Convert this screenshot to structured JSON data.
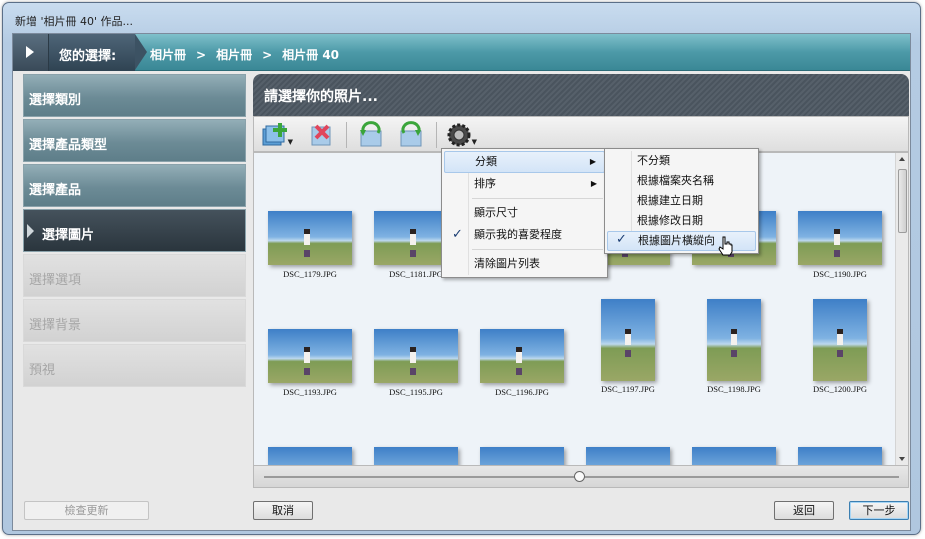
{
  "window": {
    "title": "新增 '相片冊 40' 作品..."
  },
  "breadcrumb": {
    "label": "您的選擇:",
    "path": [
      "相片冊",
      "相片冊",
      "相片冊 40"
    ],
    "separator": ">"
  },
  "nav": {
    "items": [
      {
        "label": "選擇類別",
        "state": "normal"
      },
      {
        "label": "選擇產品類型",
        "state": "normal"
      },
      {
        "label": "選擇產品",
        "state": "normal"
      },
      {
        "label": "選擇圖片",
        "state": "active"
      },
      {
        "label": "選擇選項",
        "state": "disabled"
      },
      {
        "label": "選擇背景",
        "state": "disabled"
      },
      {
        "label": "預視",
        "state": "disabled"
      }
    ]
  },
  "panel": {
    "title": "請選擇你的照片..."
  },
  "toolbar": {
    "icons": [
      "add-photos-icon",
      "remove-photo-icon",
      "rotate-left-icon",
      "rotate-right-icon",
      "settings-gear-icon"
    ]
  },
  "photos": [
    {
      "name": "DSC_1179.JPG",
      "orientation": "landscape"
    },
    {
      "name": "DSC_1181.JPG",
      "orientation": "landscape"
    },
    {
      "name": "",
      "orientation": "landscape"
    },
    {
      "name": "",
      "orientation": "landscape"
    },
    {
      "name": "",
      "orientation": "landscape"
    },
    {
      "name": "DSC_1190.JPG",
      "orientation": "landscape"
    },
    {
      "name": "DSC_1193.JPG",
      "orientation": "landscape"
    },
    {
      "name": "DSC_1195.JPG",
      "orientation": "landscape"
    },
    {
      "name": "DSC_1196.JPG",
      "orientation": "landscape"
    },
    {
      "name": "DSC_1197.JPG",
      "orientation": "portrait"
    },
    {
      "name": "DSC_1198.JPG",
      "orientation": "portrait"
    },
    {
      "name": "DSC_1200.JPG",
      "orientation": "portrait"
    },
    {
      "name": "",
      "orientation": "landscape"
    },
    {
      "name": "",
      "orientation": "landscape"
    },
    {
      "name": "",
      "orientation": "landscape"
    },
    {
      "name": "",
      "orientation": "landscape"
    },
    {
      "name": "",
      "orientation": "landscape"
    },
    {
      "name": "",
      "orientation": "landscape"
    }
  ],
  "menu": {
    "items": [
      {
        "label": "分類",
        "submenu": true,
        "highlighted": true
      },
      {
        "label": "排序",
        "submenu": true
      },
      {
        "label": "顯示尺寸"
      },
      {
        "label": "顯示我的喜愛程度",
        "checked": true
      },
      {
        "label": "清除圖片列表"
      }
    ]
  },
  "submenu": {
    "items": [
      {
        "label": "不分類"
      },
      {
        "label": "根據檔案夾名稱"
      },
      {
        "label": "根據建立日期"
      },
      {
        "label": "根據修改日期"
      },
      {
        "label": "根據圖片橫縱向",
        "checked": true,
        "highlighted": true
      }
    ]
  },
  "buttons": {
    "check_update": "檢查更新",
    "cancel": "取消",
    "back": "返回",
    "next": "下一步"
  },
  "check_mark": "✓",
  "submenu_arrow": "▶"
}
